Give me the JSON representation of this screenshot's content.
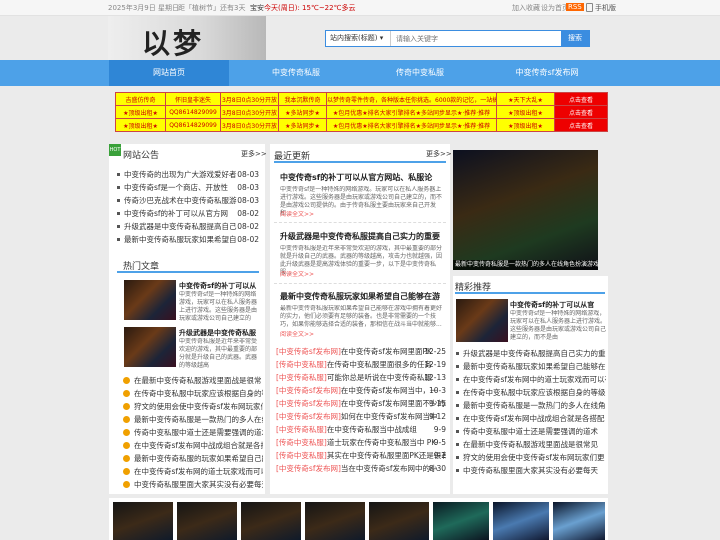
{
  "topbar": {
    "date": "2025年3月9日 星期日",
    "countdown": "距「植树节」还有3天",
    "city": "宝安",
    "weather": "今天(周日): 15℃~22℃多云",
    "favorite": "加入收藏",
    "homepage": "设为首页",
    "rss": "RSS",
    "mobile": "手机版"
  },
  "header": {
    "logo_text": "以梦",
    "search_select": "站内搜索(标题)",
    "search_placeholder": "请输入关键字",
    "search_button": "搜索"
  },
  "nav": [
    "网站首页",
    "中变传奇私服",
    "传奇中变私服",
    "中变传奇sf发布网"
  ],
  "ads": [
    [
      "吉盛仿传奇",
      "怀旧皇非迷失",
      "3月8日0点30分开放",
      "我本沉默传奇",
      "以梦传奇零件传奇，各种版本任你挑选。6000款的记忆，一站搞定",
      "★天下大乱★",
      "点击查看"
    ],
    [
      "★顶级出租★",
      "QQ8614829099",
      "3月8日0点30分开放",
      "★多站同步★",
      "★包月优惠★排名大家引擎排名★多站同步显示★·推荐·推荐",
      "★顶级出租★",
      "点击查看"
    ],
    [
      "★顶级出租★",
      "QQ8614829099",
      "3月8日0点30分开放",
      "★多站同步★",
      "★包月优惠★排名大家引擎排名★多站同步显示★·推荐·推荐",
      "★顶级出租★",
      "点击查看"
    ]
  ],
  "notice": {
    "title": "网站公告",
    "more": "更多>>",
    "items": [
      {
        "text": "中变传奇的出现为广大游戏爱好者",
        "date": "08-03"
      },
      {
        "text": "中变传奇sf是一个商店、开放性",
        "date": "08-03"
      },
      {
        "text": "传奇沙巴克战术在中变传奇私服游",
        "date": "08-03"
      },
      {
        "text": "中变传奇sf的补丁可以从官方网",
        "date": "08-02"
      },
      {
        "text": "升级武器是中变传奇私服提高自己",
        "date": "08-02"
      },
      {
        "text": "最新中变传奇私服玩家如果希望自",
        "date": "08-02"
      }
    ]
  },
  "hot": {
    "title": "热门文章",
    "cards": [
      {
        "title": "中变传奇sf的补丁可以从",
        "desc": "中变传奇sf是一种特殊的网络游戏，玩家可以在私人服务器上进行游戏。这些服务器是由玩家或游戏公司自己建立的"
      },
      {
        "title": "升级武器是中变传奇私服",
        "desc": "中变传奇私服是近年来非常受欢迎的游戏，其中最重要的部分就是升级自己的武器。武器的等级越高"
      }
    ],
    "items": [
      "在最新中变传奇私服游戏里面战是很常",
      "在传奇中变私服中玩家应该根据自身的等",
      "狩文的使用会使中变传奇sf发布网玩家们",
      "最新中变传奇私服是一款热门的多人在线",
      "传奇中变私服中道士还是需要强调的道术",
      "在中变传奇sf发布网中战成组合就是各搭",
      "最新中变传奇私服的玩家如果希望自己能够",
      "在中变传奇sf发布网的道士玩家戏而可以有",
      "中变传奇私服里面大家其实没有必要每天"
    ]
  },
  "news": {
    "title": "最近更新",
    "more": "更多>>",
    "articles": [
      {
        "title": "中变传奇sf的补丁可以从官方网站、私服论",
        "desc": "中变传奇sf是一种特殊的网络游戏。玩家可以在私人服务器上进行游戏。这些服务器是由玩家或游戏公司自己建立的，而不是由游戏公司提供的。由于传奇私服主要由玩家来自己开发和...",
        "link": "阅读全文>>"
      },
      {
        "title": "升级武器是中变传奇私服提高自己实力的重要",
        "desc": "中变传奇私服是近年来非常受欢迎的游戏，其中最重要的部分就是升级自己的武器。武器的等级越高，攻击力也就越强，因此升级武器是提高游戏体验的重要一步，以下是中变传奇私服...",
        "link": "阅读全文>>"
      },
      {
        "title": "最新中变传奇私服玩家如果希望自己能够在游",
        "desc": "最新中变传奇私服玩家如果希望自己能够在游戏中拥有着更好的实力，他们必须要有足够的装备。也是非常需要的一个技巧，如果你能够选择合适的装备，那相信在战斗当中就能够...",
        "link": "阅读全文>>"
      }
    ],
    "list": [
      {
        "cat": "[中变传奇sf发布网]",
        "text": "在中变传奇sf发布网里面PK",
        "date": "12-25"
      },
      {
        "cat": "[传奇中变私服]",
        "text": "在传奇中变私服里面很多的任务",
        "date": "12-19"
      },
      {
        "cat": "[中变传奇私服]",
        "text": "可能你总是听说在中变传奇私服",
        "date": "12-13"
      },
      {
        "cat": "[中变传奇sf发布网]",
        "text": "在中变传奇sf发布网当中，一",
        "date": "10-3"
      },
      {
        "cat": "[中变传奇sf发布网]",
        "text": "在中变传奇sf发布网里面不少的玩家",
        "date": "9-15"
      },
      {
        "cat": "[中变传奇sf发布网]",
        "text": "如何在中变传奇sf发布网当中",
        "date": "9-12"
      },
      {
        "cat": "[中变传奇私服]",
        "text": "在中变传奇私服当中战成组",
        "date": "9-9"
      },
      {
        "cat": "[传奇中变私服]",
        "text": "道士玩家在传奇中变私服当中 PK",
        "date": "9-5"
      },
      {
        "cat": "[传奇中变私服]",
        "text": "其实在中变传奇私服里面PK还是很有",
        "date": "9-2"
      },
      {
        "cat": "[中变传奇sf发布网]",
        "text": "当在中变传奇sf发布网中的小",
        "date": "8-30"
      }
    ]
  },
  "banner": {
    "caption": "最新中变传奇私服是一款热门的多人在线角色扮演游戏"
  },
  "featured": {
    "title": "精彩推荐",
    "card": {
      "title": "中变传奇sf的补丁可以从官",
      "desc": "中变传奇sf是一种特殊的网络游戏，玩家可以在私人服务器上进行游戏。这些服务器是由玩家或游戏公司自己建立的，而不是由"
    },
    "items": [
      "升级武器是中变传奇私服提高自己实力的重",
      "最新中变传奇私服玩家如果希望自己能够在",
      "在中变传奇sf发布网中的道士玩家戏而可以有",
      "在传奇中变私服中玩家应该根据自身的等级",
      "最新中变传奇私服是一款热门的多人在线角",
      "在中变传奇sf发布网中战成组合就是各搭配",
      "传奇中变私服中道士还是需要强调的道术",
      "在最新中变传奇私服游戏里面战是很常见",
      "狩文的使用会使中变传奇sf发布网玩家们更",
      "中变传奇私服里面大家其实没有必要每天"
    ]
  }
}
